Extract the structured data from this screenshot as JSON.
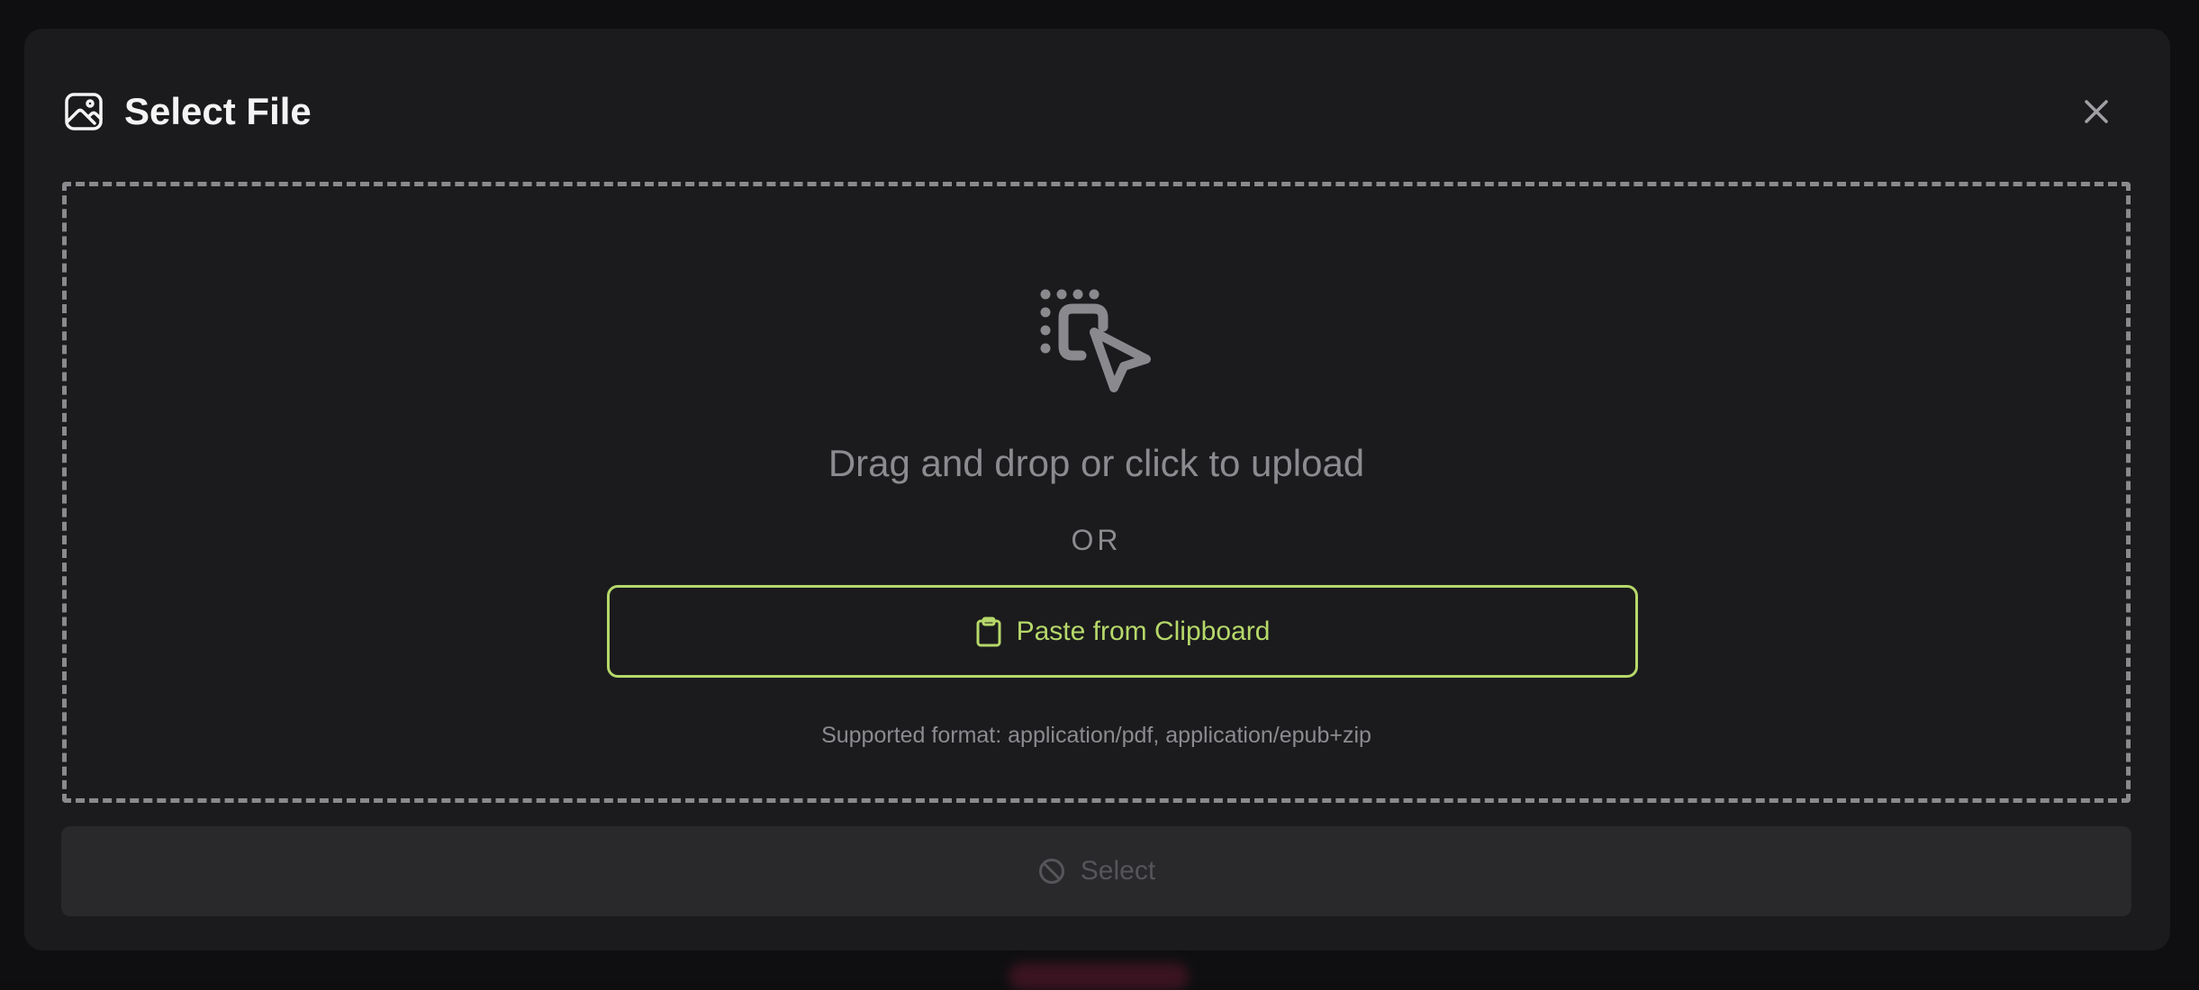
{
  "dialog": {
    "title": "Select File",
    "icons": {
      "header": "image-icon",
      "close": "close-icon"
    }
  },
  "dropzone": {
    "instruction": "Drag and drop or click to upload",
    "separator": "OR",
    "icon": "drag-drop-icon",
    "paste_button": {
      "label": "Paste from Clipboard",
      "icon": "clipboard-icon"
    },
    "supported_text": "Supported format: application/pdf, application/epub+zip"
  },
  "footer": {
    "select_button": {
      "label": "Select",
      "icon": "ban-icon",
      "disabled": true
    }
  },
  "colors": {
    "accent": "#b6d86a",
    "muted_text": "#8b8b90",
    "modal_bg": "#1b1b1d",
    "disabled_button_bg": "#29292c"
  }
}
